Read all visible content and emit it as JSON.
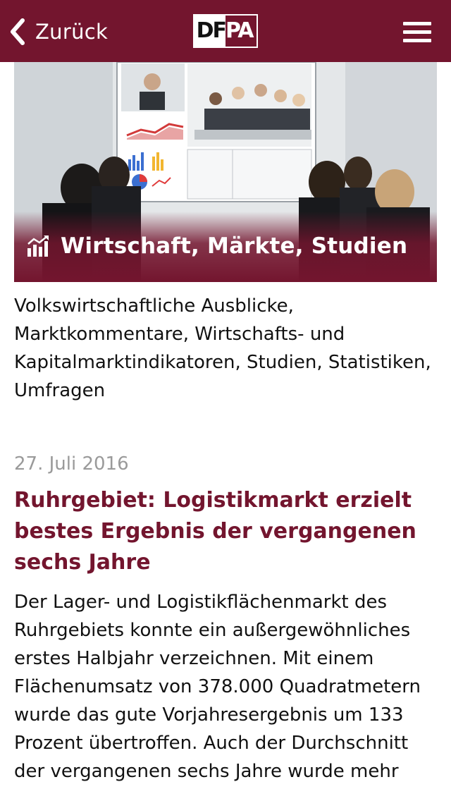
{
  "header": {
    "back_label": "Zurück",
    "logo_left": "DF",
    "logo_right": "PA",
    "brand_color": "#73152e"
  },
  "hero": {
    "title": "Wirtschaft, Märkte, Studien",
    "icon": "chart-growth-icon"
  },
  "section": {
    "description": "Volkswirtschaftliche Ausblicke, Marktkommentare, Wirtschafts- und Kapitalmarktindikatoren, Studien, Statistiken, Umfragen"
  },
  "article": {
    "date": "27. Juli 2016",
    "headline": "Ruhrgebiet: Logistikmarkt erzielt bestes Ergebnis der vergangenen sechs Jahre",
    "body": "Der Lager- und Logistikflächenmarkt des Ruhrgebiets konnte ein außergewöhnliches erstes Halbjahr verzeichnen. Mit einem Flächenumsatz von 378.000 Quadratmetern wurde das gute Vorjahresergebnis um 133 Prozent übertroffen. Auch der Durchschnitt der vergangenen sechs Jahre wurde mehr"
  }
}
